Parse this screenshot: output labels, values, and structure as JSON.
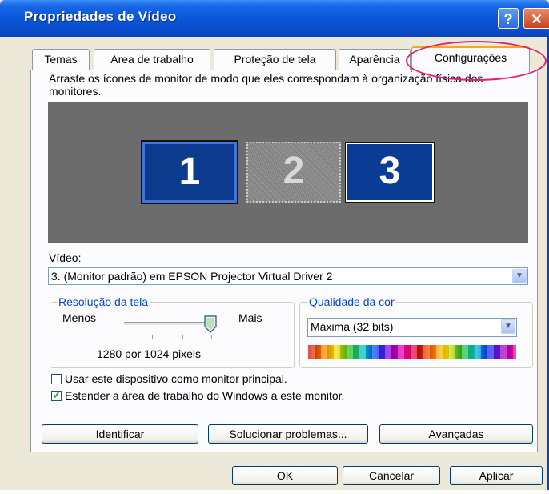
{
  "window": {
    "title": "Propriedades de Vídeo",
    "help_glyph": "?",
    "close_glyph": "✕"
  },
  "tabs": [
    {
      "label": "Temas",
      "active": false
    },
    {
      "label": "Área de trabalho",
      "active": false
    },
    {
      "label": "Proteção de tela",
      "active": false
    },
    {
      "label": "Aparência",
      "active": false
    },
    {
      "label": "Configurações",
      "active": true
    }
  ],
  "description": "Arraste os ícones de monitor de modo que eles correspondam à organização física dos monitores.",
  "monitors": [
    {
      "number": "1",
      "state": "selected"
    },
    {
      "number": "2",
      "state": "inactive"
    },
    {
      "number": "3",
      "state": "active"
    }
  ],
  "video": {
    "label": "Vídeo:",
    "value": "3. (Monitor padrão) em EPSON Projector Virtual Driver 2"
  },
  "resolution": {
    "label": "Resolução da tela",
    "less": "Menos",
    "more": "Mais",
    "value": "1280 por 1024 pixels",
    "slider_position": 1.0
  },
  "color_quality": {
    "label": "Qualidade da cor",
    "value": "Máxima (32 bits)"
  },
  "options": {
    "primary_monitor": {
      "label": "Usar este dispositivo como monitor principal.",
      "checked": false
    },
    "extend_desktop": {
      "label": "Estender a área de trabalho do Windows a este monitor.",
      "checked": true
    }
  },
  "buttons": {
    "identify": "Identificar",
    "troubleshoot": "Solucionar problemas...",
    "advanced": "Avançadas",
    "ok": "OK",
    "cancel": "Cancelar",
    "apply": "Aplicar"
  },
  "colors": {
    "title_bar": "#0a54d8",
    "accent_link": "#0046d5",
    "highlight_ring": "#e0207a"
  }
}
